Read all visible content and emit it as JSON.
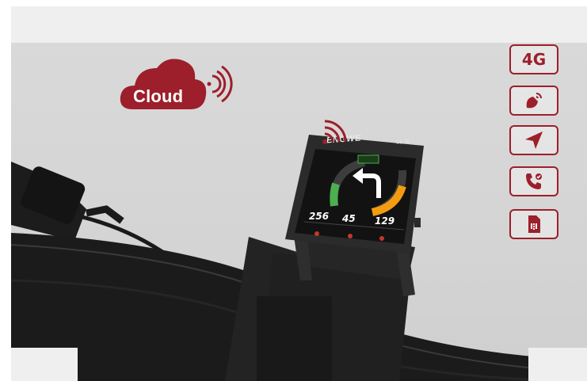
{
  "cloud": {
    "label": "Cloud",
    "icon": "cloud-icon"
  },
  "device": {
    "brand": "ENGWE",
    "time": "03:30",
    "values": [
      "256",
      "45",
      "129"
    ]
  },
  "features": [
    {
      "name": "4g",
      "label": "4G",
      "icon": "4g-signal-icon"
    },
    {
      "name": "satellite",
      "icon": "satellite-dish-icon"
    },
    {
      "name": "gps",
      "icon": "navigation-arrow-icon"
    },
    {
      "name": "call",
      "icon": "phone-call-icon"
    },
    {
      "name": "sim",
      "icon": "sim-card-icon"
    }
  ],
  "colors": {
    "accent": "#9c1f2b",
    "background": "#d6d6d6",
    "device": "#2a2a2a",
    "green": "#4caf50",
    "orange": "#f39c12"
  }
}
